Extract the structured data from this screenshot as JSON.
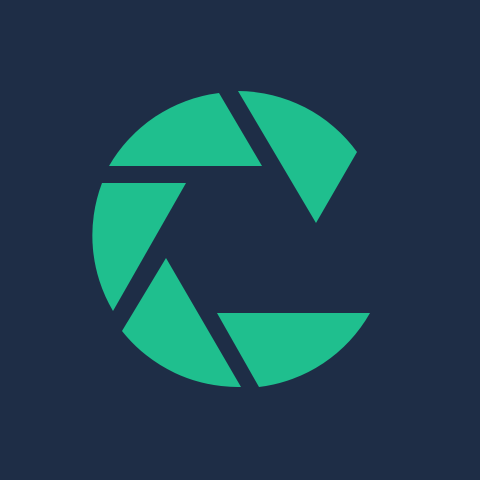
{
  "colors": {
    "background": "#1e2d46",
    "accent": "#1fbf8e"
  },
  "logo": {
    "icon": "camera-aperture-icon",
    "blade_count": 5
  }
}
